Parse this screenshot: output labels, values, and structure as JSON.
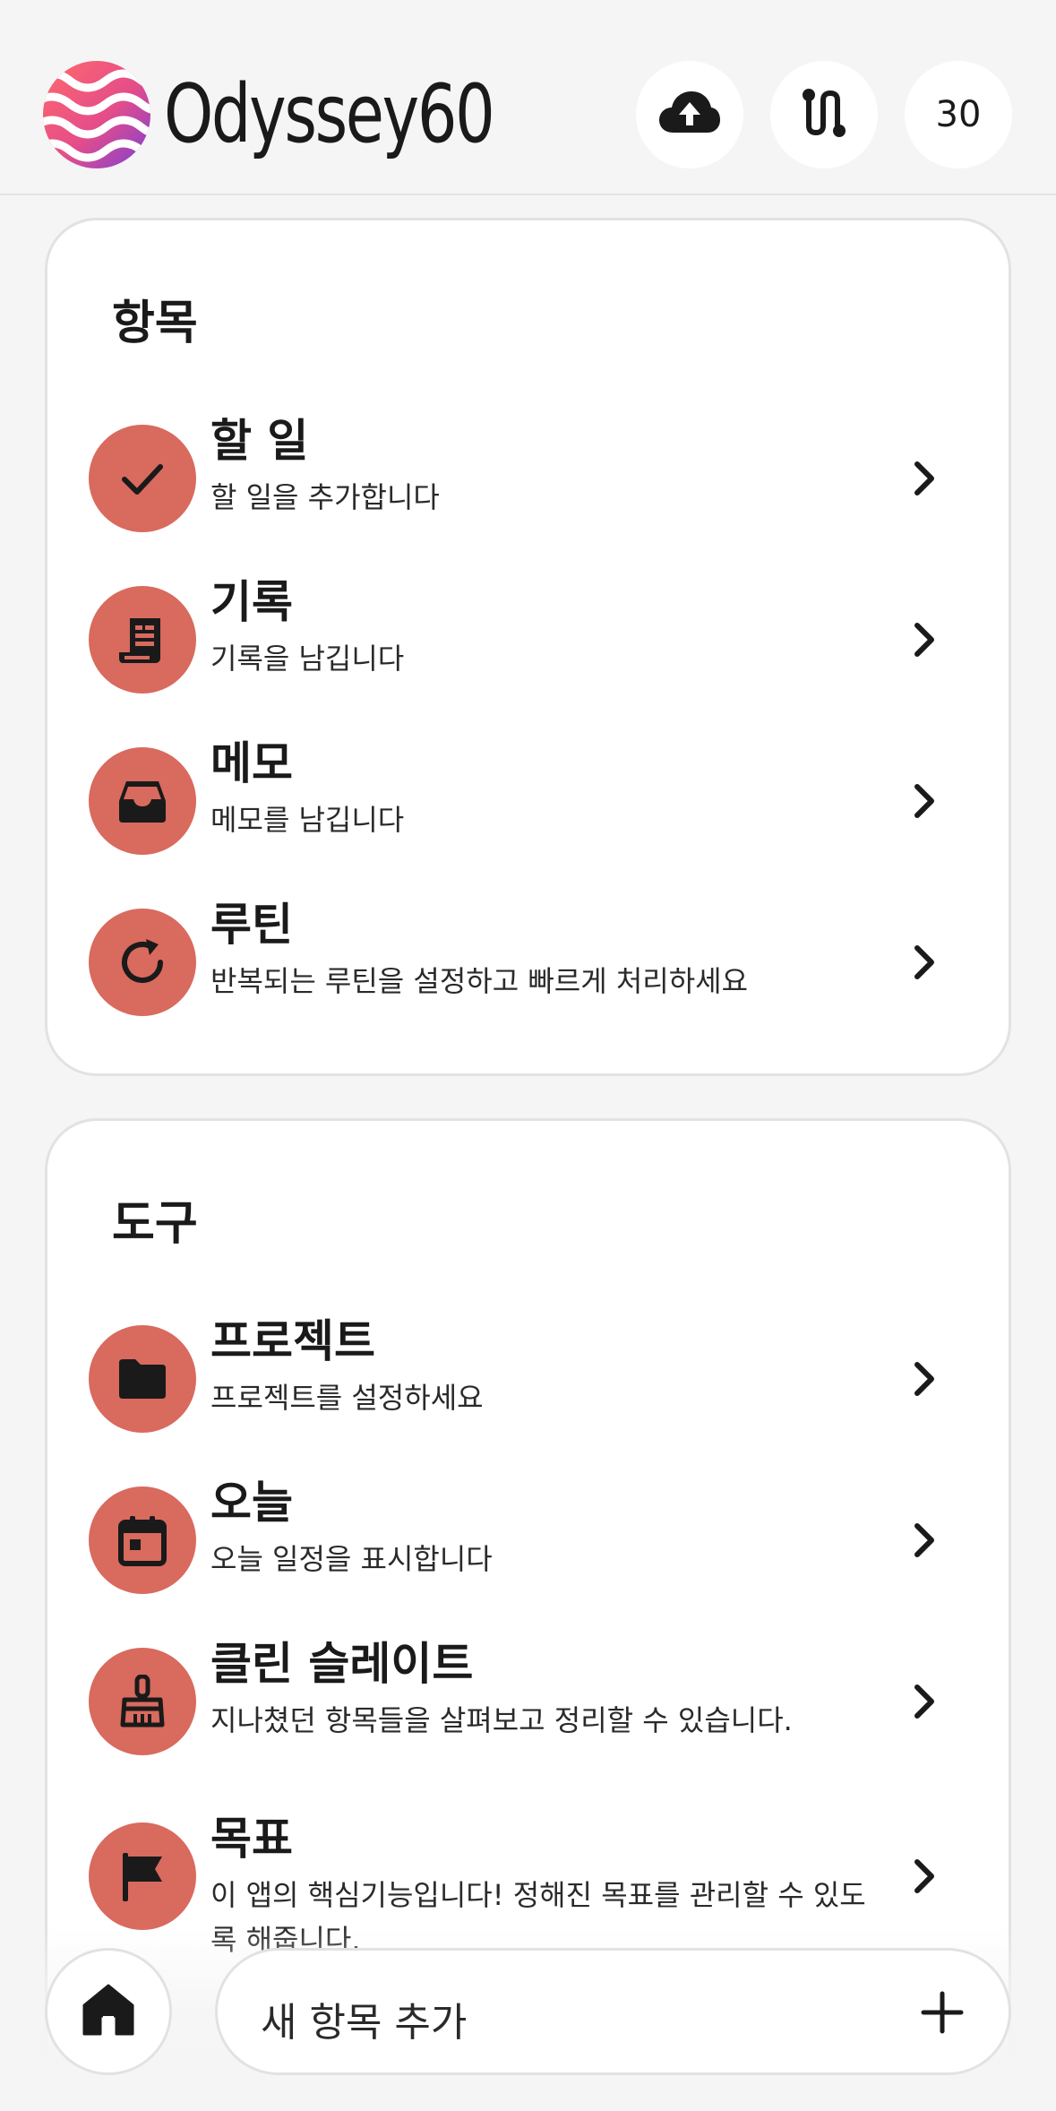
{
  "header": {
    "brand": "Odyssey60",
    "upload_icon": "cloud-upload-icon",
    "route_icon": "route-icon",
    "counter": "30"
  },
  "sections": [
    {
      "title": "항목",
      "items": [
        {
          "title": "할 일",
          "subtitle": "할 일을 추가합니다",
          "icon": "check-icon"
        },
        {
          "title": "기록",
          "subtitle": "기록을 남깁니다",
          "icon": "receipt-icon"
        },
        {
          "title": "메모",
          "subtitle": "메모를 남깁니다",
          "icon": "inbox-icon"
        },
        {
          "title": "루틴",
          "subtitle": "반복되는 루틴을 설정하고 빠르게 처리하세요",
          "icon": "refresh-icon"
        }
      ]
    },
    {
      "title": "도구",
      "items": [
        {
          "title": "프로젝트",
          "subtitle": "프로젝트를 설정하세요",
          "icon": "folder-icon"
        },
        {
          "title": "오늘",
          "subtitle": "오늘 일정을 표시합니다",
          "icon": "calendar-icon"
        },
        {
          "title": "클린 슬레이트",
          "subtitle": "지나쳤던 항목들을 살펴보고 정리할 수 있습니다.",
          "icon": "broom-icon"
        },
        {
          "title": "목표",
          "subtitle": "이 앱의 핵심기능입니다! 정해진 목표를 관리할 수 있도록 해줍니다.",
          "icon": "flag-icon"
        }
      ]
    }
  ],
  "bottom_bar": {
    "home_icon": "home-icon",
    "add_label": "새 항목 추가",
    "add_icon": "plus-icon"
  },
  "colors": {
    "accent": "#d96a5e",
    "background": "#f5f5f5",
    "card": "#ffffff"
  }
}
